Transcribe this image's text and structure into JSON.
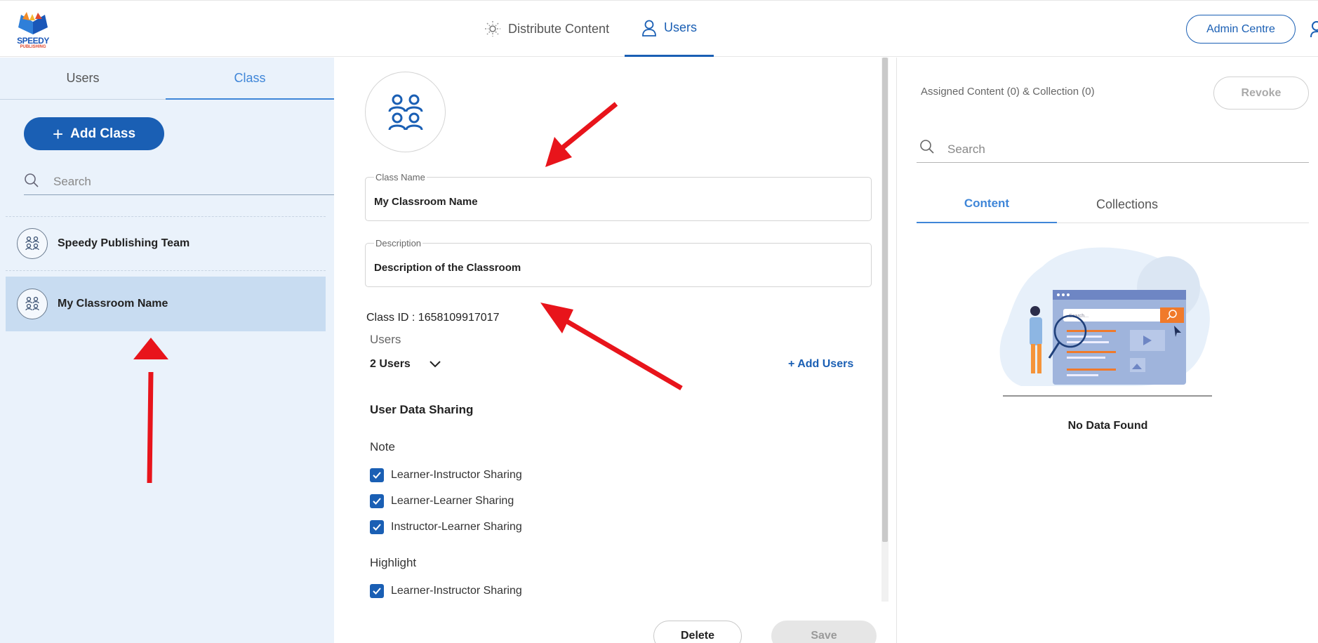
{
  "brand": {
    "name": "SPEEDY",
    "sub": "PUBLISHING"
  },
  "topnav": {
    "distribute_label": "Distribute Content",
    "users_label": "Users",
    "admin_label": "Admin Centre"
  },
  "left": {
    "tabs": {
      "users": "Users",
      "class": "Class"
    },
    "add_class_label": "Add Class",
    "search_placeholder": "Search",
    "classes": [
      {
        "name": "Speedy Publishing Team",
        "selected": false
      },
      {
        "name": "My Classroom Name",
        "selected": true
      }
    ]
  },
  "details": {
    "class_name_label": "Class Name",
    "class_name_value": "My Classroom Name",
    "description_label": "Description",
    "description_value": "Description of the Classroom",
    "class_id_text": "Class ID : 1658109917017",
    "users_label": "Users",
    "users_count": "2 Users",
    "add_users_label": "+ Add Users",
    "sharing_title": "User Data Sharing",
    "note_label": "Note",
    "note_options": [
      {
        "label": "Learner-Instructor Sharing",
        "checked": true
      },
      {
        "label": "Learner-Learner Sharing",
        "checked": true
      },
      {
        "label": "Instructor-Learner Sharing",
        "checked": true
      }
    ],
    "highlight_label": "Highlight",
    "highlight_options": [
      {
        "label": "Learner-Instructor Sharing",
        "checked": true
      }
    ],
    "delete_label": "Delete",
    "save_label": "Save"
  },
  "right": {
    "assigned_text": "Assigned Content (0) & Collection (0)",
    "revoke_label": "Revoke",
    "search_placeholder": "Search",
    "tabs": {
      "content": "Content",
      "collections": "Collections"
    },
    "illustration_search_text": "Search...",
    "empty_text": "No Data Found"
  },
  "colors": {
    "primary": "#1a5fb4",
    "accent_tab": "#3f86d8",
    "left_bg": "#eaf2fb",
    "selected_row": "#c8dcf1",
    "annotation_red": "#e8141b"
  }
}
